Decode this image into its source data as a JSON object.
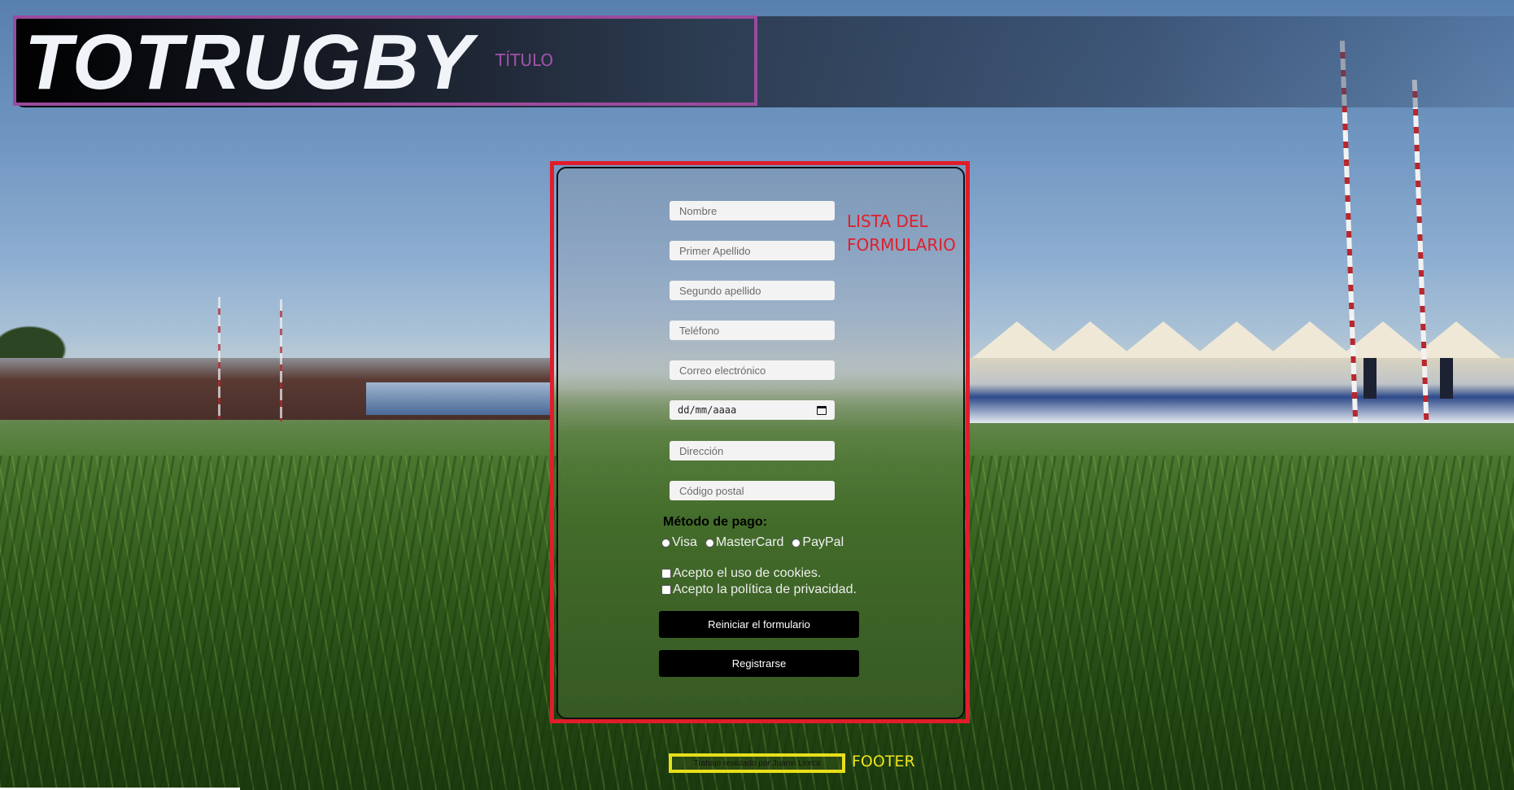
{
  "header": {
    "brand": "TOTRUGBY",
    "annotation_label": "TÍTULO",
    "annotation_color": "#9b4b9d"
  },
  "form": {
    "annotation_label_line1": "LISTA DEL",
    "annotation_label_line2": "FORMULARIO",
    "annotation_color": "#e01e2b",
    "fields": {
      "nombre_placeholder": "Nombre",
      "primer_apellido_placeholder": "Primer Apellido",
      "segundo_apellido_placeholder": "Segundo apellido",
      "telefono_placeholder": "Teléfono",
      "correo_placeholder": "Correo electrónico",
      "fecha_placeholder": "dd/mm/aaaa",
      "direccion_placeholder": "Dirección",
      "codigo_postal_placeholder": "Código postal"
    },
    "payment": {
      "title": "Método de pago:",
      "options": [
        "Visa",
        "MasterCard",
        "PayPal"
      ]
    },
    "checkboxes": {
      "cookies": "Acepto el uso de cookies.",
      "privacy": "Acepto la política de privacidad."
    },
    "buttons": {
      "reset": "Reiniciar el formulario",
      "submit": "Registrarse"
    }
  },
  "footer": {
    "text": "Trabajo realizado por Juanvi Llorca",
    "annotation_label": "FOOTER",
    "annotation_color": "#eee31c"
  },
  "icons": {
    "calendar": "calendar-icon"
  }
}
